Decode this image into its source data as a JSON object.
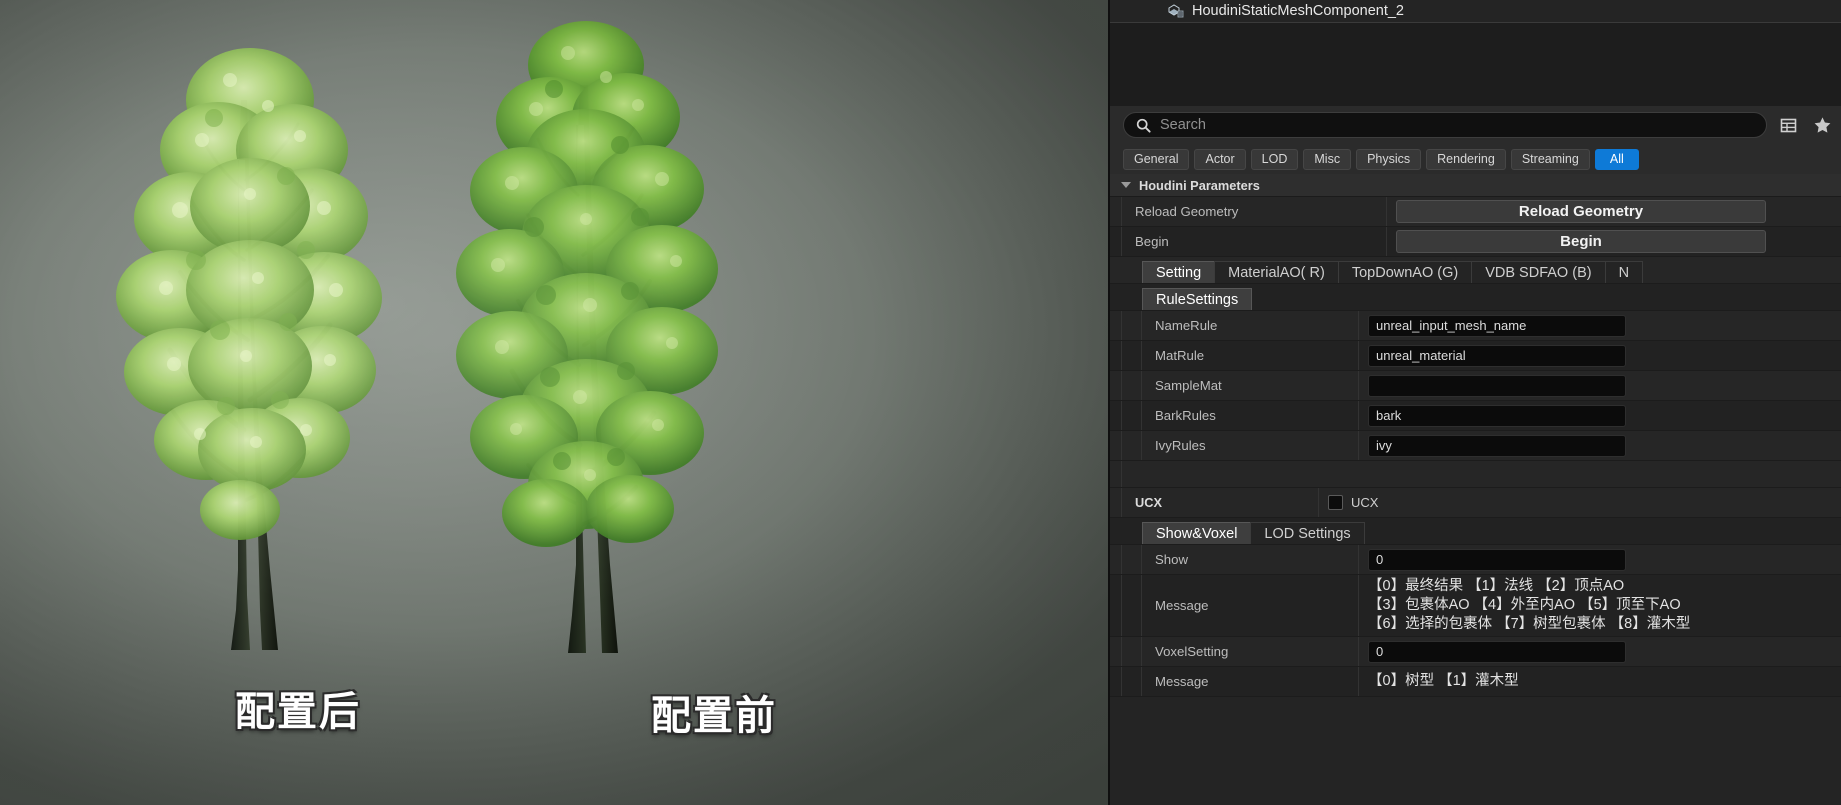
{
  "viewport": {
    "label_after": "配置后",
    "label_before": "配置前"
  },
  "outliner": {
    "component_name": "HoudiniStaticMeshComponent_2",
    "component_icon": "static-mesh-component-icon"
  },
  "search": {
    "placeholder": "Search",
    "icon": "search-icon",
    "grid_view_icon": "grid-view-icon",
    "favorites_icon": "star-icon"
  },
  "filter_tabs": [
    {
      "label": "General",
      "active": false
    },
    {
      "label": "Actor",
      "active": false
    },
    {
      "label": "LOD",
      "active": false
    },
    {
      "label": "Misc",
      "active": false
    },
    {
      "label": "Physics",
      "active": false
    },
    {
      "label": "Rendering",
      "active": false
    },
    {
      "label": "Streaming",
      "active": false
    },
    {
      "label": "All",
      "active": true
    }
  ],
  "accent_color": "#0e7ad7",
  "section": {
    "title": "Houdini Parameters",
    "expanded": true,
    "collapse_icon": "triangle-down-icon"
  },
  "rows": {
    "reload_geometry": {
      "label": "Reload Geometry",
      "button": "Reload Geometry"
    },
    "begin": {
      "label": "Begin",
      "button": "Begin"
    }
  },
  "main_tabs": [
    {
      "label": "Setting",
      "selected": true
    },
    {
      "label": "MaterialAO( R)",
      "selected": false
    },
    {
      "label": "TopDownAO (G)",
      "selected": false
    },
    {
      "label": "VDB SDFAO (B)",
      "selected": false
    },
    {
      "label": "N",
      "selected": false
    }
  ],
  "rule_settings": {
    "tab_label": "RuleSettings",
    "fields": [
      {
        "label": "NameRule",
        "value": "unreal_input_mesh_name"
      },
      {
        "label": "MatRule",
        "value": "unreal_material"
      },
      {
        "label": "SampleMat",
        "value": ""
      },
      {
        "label": "BarkRules",
        "value": "bark"
      },
      {
        "label": "IvyRules",
        "value": "ivy"
      }
    ]
  },
  "ucx": {
    "label": "UCX",
    "checkbox_label": "UCX",
    "checked": false
  },
  "show_voxel": {
    "tabs": [
      {
        "label": "Show&Voxel",
        "selected": true
      },
      {
        "label": "LOD Settings",
        "selected": false
      }
    ],
    "show": {
      "label": "Show",
      "value": "0"
    },
    "show_message": {
      "label": "Message",
      "lines": [
        "【0】最终结果 【1】法线 【2】顶点AO",
        "【3】包裹体AO 【4】外至内AO 【5】顶至下AO",
        "【6】选择的包裹体 【7】树型包裹体 【8】灌木型"
      ]
    },
    "voxel_setting": {
      "label": "VoxelSetting",
      "value": "0"
    },
    "voxel_message": {
      "label": "Message",
      "text": "【0】树型 【1】灌木型"
    }
  }
}
